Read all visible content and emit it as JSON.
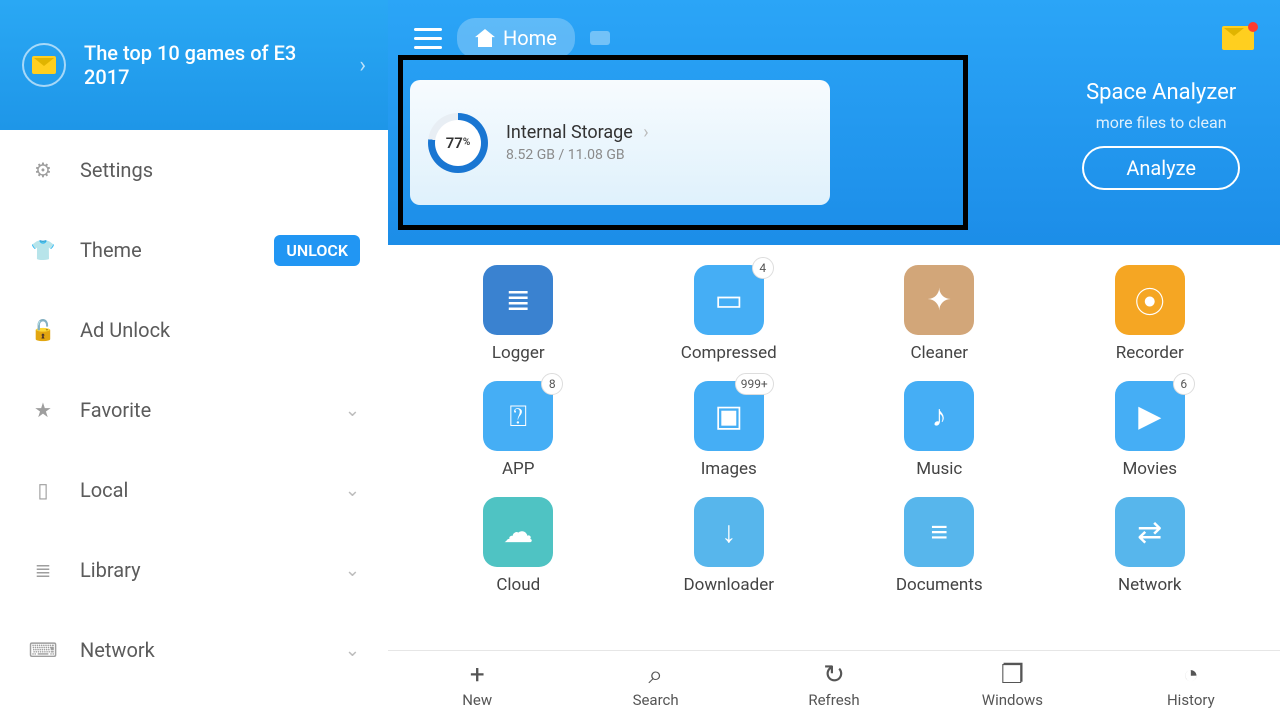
{
  "banner": {
    "text": "The top 10 games of E3 2017"
  },
  "sidebar": [
    {
      "icon": "gear-icon",
      "label": "Settings",
      "badge": "",
      "expand": false
    },
    {
      "icon": "shirt-icon",
      "label": "Theme",
      "badge": "UNLOCK",
      "expand": false
    },
    {
      "icon": "lock-icon",
      "label": "Ad Unlock",
      "badge": "",
      "expand": false
    },
    {
      "icon": "star-icon",
      "label": "Favorite",
      "badge": "",
      "expand": true
    },
    {
      "icon": "phone-icon",
      "label": "Local",
      "badge": "",
      "expand": true
    },
    {
      "icon": "layers-icon",
      "label": "Library",
      "badge": "",
      "expand": true
    },
    {
      "icon": "router-icon",
      "label": "Network",
      "badge": "",
      "expand": true
    }
  ],
  "breadcrumb": {
    "label": "Home"
  },
  "storage": {
    "percent": "77",
    "percent_suffix": "%",
    "title": "Internal Storage",
    "used": "8.52 GB",
    "total": "11.08 GB",
    "sub": "8.52 GB / 11.08 GB"
  },
  "analyzer": {
    "title": "Space Analyzer",
    "sub": "more files to clean",
    "button": "Analyze"
  },
  "tiles": [
    {
      "label": "Logger",
      "color": "c-blue",
      "glyph": "≣",
      "badge": ""
    },
    {
      "label": "Compressed",
      "color": "c-lblue",
      "glyph": "▭",
      "badge": "4"
    },
    {
      "label": "Cleaner",
      "color": "c-sand",
      "glyph": "✦",
      "badge": ""
    },
    {
      "label": "Recorder",
      "color": "c-orange",
      "glyph": "⦿",
      "badge": ""
    },
    {
      "label": "APP",
      "color": "c-lblue",
      "glyph": "⍰",
      "badge": "8"
    },
    {
      "label": "Images",
      "color": "c-lblue",
      "glyph": "▣",
      "badge": "999+"
    },
    {
      "label": "Music",
      "color": "c-lblue",
      "glyph": "♪",
      "badge": ""
    },
    {
      "label": "Movies",
      "color": "c-lblue",
      "glyph": "▶",
      "badge": "6"
    },
    {
      "label": "Cloud",
      "color": "c-teal",
      "glyph": "☁",
      "badge": ""
    },
    {
      "label": "Downloader",
      "color": "c-sky",
      "glyph": "↓",
      "badge": ""
    },
    {
      "label": "Documents",
      "color": "c-sky",
      "glyph": "≡",
      "badge": ""
    },
    {
      "label": "Network",
      "color": "c-sky",
      "glyph": "⇄",
      "badge": ""
    }
  ],
  "bottom": [
    {
      "label": "New",
      "glyph": "+"
    },
    {
      "label": "Search",
      "glyph": "⌕"
    },
    {
      "label": "Refresh",
      "glyph": "↻"
    },
    {
      "label": "Windows",
      "glyph": "❐"
    },
    {
      "label": "History",
      "glyph": "◔"
    }
  ]
}
